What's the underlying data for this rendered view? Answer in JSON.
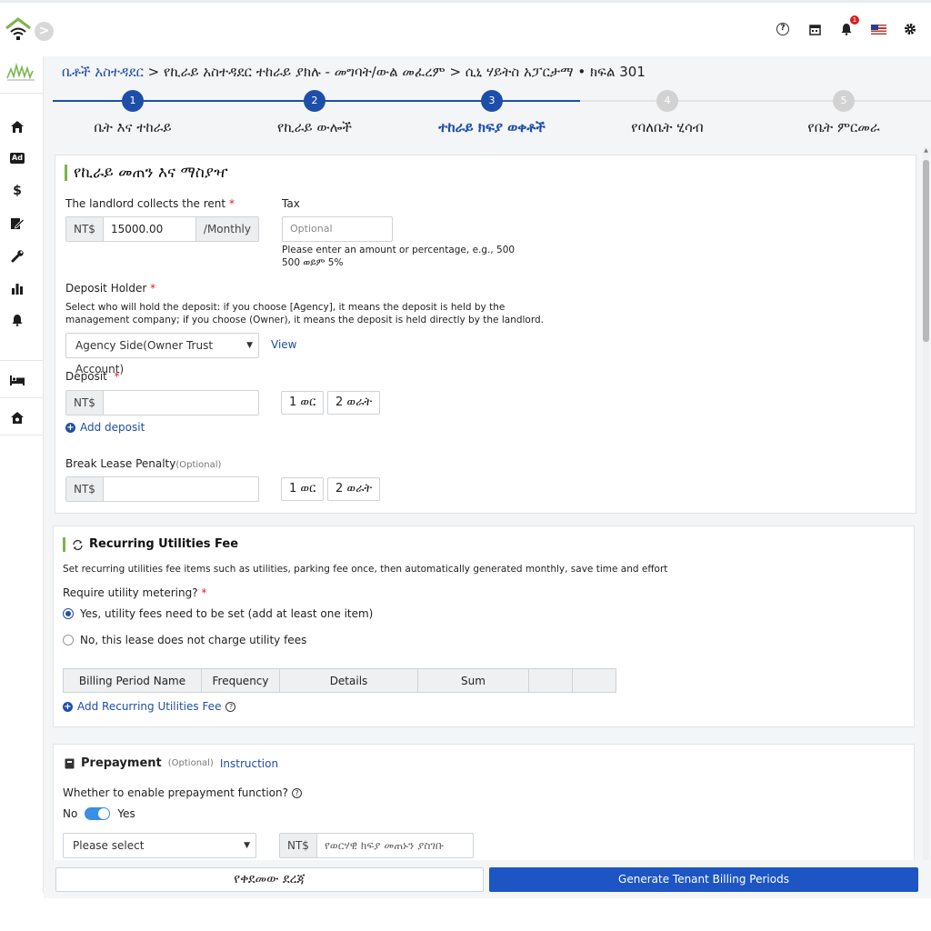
{
  "header": {
    "collapse_label": ">"
  },
  "top_icons": {
    "notifications_count": "1",
    "help_label": "?"
  },
  "sidebar": {
    "items": [
      {
        "icon": "home-icon",
        "glyph": "⌂"
      },
      {
        "icon": "ad-icon",
        "glyph": "Ad"
      },
      {
        "icon": "dollar-icon",
        "glyph": "$"
      },
      {
        "icon": "sign-icon",
        "glyph": "✍"
      },
      {
        "icon": "wrench-icon",
        "glyph": "🔧"
      },
      {
        "icon": "chart-icon",
        "glyph": "▮"
      },
      {
        "icon": "bell-icon",
        "glyph": "🔔"
      },
      {
        "icon": "bed-icon",
        "glyph": "🛏"
      },
      {
        "icon": "house-settings-icon",
        "glyph": "⌂"
      }
    ]
  },
  "breadcrumb": {
    "root": "ቤቶች አስተዳደር",
    "rest": " > የኪራይ አስተዳደር ተከራይ ያክሉ - መግባት/ውል መፈረም > ሲኒ ሃይትስ አፓርታማ • ክፍል 301"
  },
  "steps": [
    {
      "num": "1",
      "label": "ቤት እና ተከራይ"
    },
    {
      "num": "2",
      "label": "የኪራይ ውሎች"
    },
    {
      "num": "3",
      "label": "ተከራይ ክፍያ ወቀቶች"
    },
    {
      "num": "4",
      "label": "የባለቤት ሂሳብ"
    },
    {
      "num": "5",
      "label": "የቤት ምርመራ"
    }
  ],
  "rent_section": {
    "title": "የኪራይ መጠን እና ማስያዣ",
    "collects_label": "The landlord collects the rent",
    "currency": "NT$",
    "rent_value": "15000.00",
    "period": "/Monthly",
    "tax_label": "Tax",
    "tax_placeholder": "Optional",
    "tax_hint_line1": "Please enter an amount or percentage, e.g., 500",
    "tax_hint_line2": "500 ወይም 5%",
    "deposit_holder_label": "Deposit Holder",
    "deposit_holder_hint_line1": "Select who will hold the deposit: if you choose [Agency], it means the deposit is held by the",
    "deposit_holder_hint_line2": "management company; if you choose (Owner), it means the deposit is held directly by the landlord.",
    "deposit_holder_value": "Agency Side(Owner Trust Account)",
    "view_label": "View",
    "deposit_label": "Deposit",
    "deposit_currency": "NT$",
    "one_month": "1 ወር",
    "two_months": "2 ወራት",
    "add_deposit": "Add deposit",
    "penalty_label": "Break Lease Penalty",
    "penalty_optional": "(Optional)",
    "penalty_currency": "NT$",
    "penalty_one_month": "1 ወር",
    "penalty_two_months": "2 ወራት"
  },
  "utilities_section": {
    "title": "Recurring Utilities Fee",
    "description": "Set recurring utilities fee items such as utilities, parking fee once, then automatically generated monthly, save time and effort",
    "metering_label": "Require utility metering?",
    "option_yes": "Yes, utility fees need to be set (add at least one item)",
    "option_no": "No, this lease does not charge utility fees",
    "table_headers": [
      "Billing Period Name",
      "Frequency",
      "Details",
      "Sum",
      "",
      ""
    ],
    "add_label": "Add Recurring Utilities Fee"
  },
  "prepayment_section": {
    "title": "Prepayment",
    "optional": "(Optional)",
    "instruction": "Instruction",
    "question": "Whether to enable prepayment function?",
    "toggle_no": "No",
    "toggle_yes": "Yes",
    "select_placeholder": "Please select",
    "currency": "NT$",
    "amount_placeholder": "የወርሃዊ ክፍያ መጠኑን ያስገቡ"
  },
  "footer": {
    "prev_label": "የቀደመው ደረጃ",
    "generate_label": "Generate Tenant Billing Periods"
  },
  "colors": {
    "primary": "#1e4fa8",
    "button": "#1d55c4",
    "accent_green": "#7bb64a",
    "required": "#d62222"
  }
}
